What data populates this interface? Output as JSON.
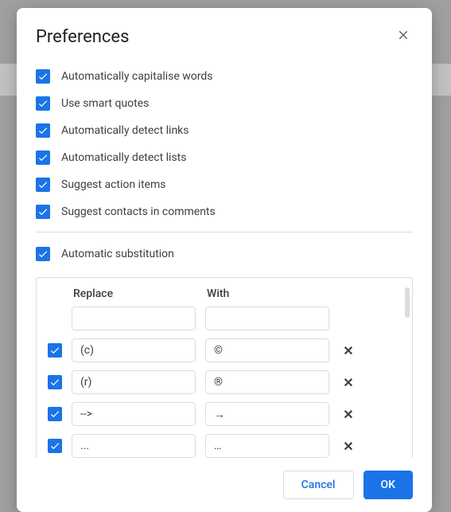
{
  "dialog": {
    "title": "Preferences",
    "options": [
      {
        "label": "Automatically capitalise words",
        "checked": true
      },
      {
        "label": "Use smart quotes",
        "checked": true
      },
      {
        "label": "Automatically detect links",
        "checked": true
      },
      {
        "label": "Automatically detect lists",
        "checked": true
      },
      {
        "label": "Suggest action items",
        "checked": true
      },
      {
        "label": "Suggest contacts in comments",
        "checked": true
      }
    ],
    "auto_substitution": {
      "label": "Automatic substitution",
      "checked": true
    },
    "substitution": {
      "header_replace": "Replace",
      "header_with": "With",
      "rows": [
        {
          "checked": null,
          "replace": "",
          "with": "",
          "deletable": false
        },
        {
          "checked": true,
          "replace": "(c)",
          "with": "©",
          "deletable": true
        },
        {
          "checked": true,
          "replace": "(r)",
          "with": "®",
          "deletable": true
        },
        {
          "checked": true,
          "replace": "-->",
          "with": "→",
          "deletable": true
        },
        {
          "checked": true,
          "replace": "...",
          "with": "…",
          "deletable": true
        }
      ]
    },
    "buttons": {
      "cancel": "Cancel",
      "ok": "OK"
    }
  }
}
